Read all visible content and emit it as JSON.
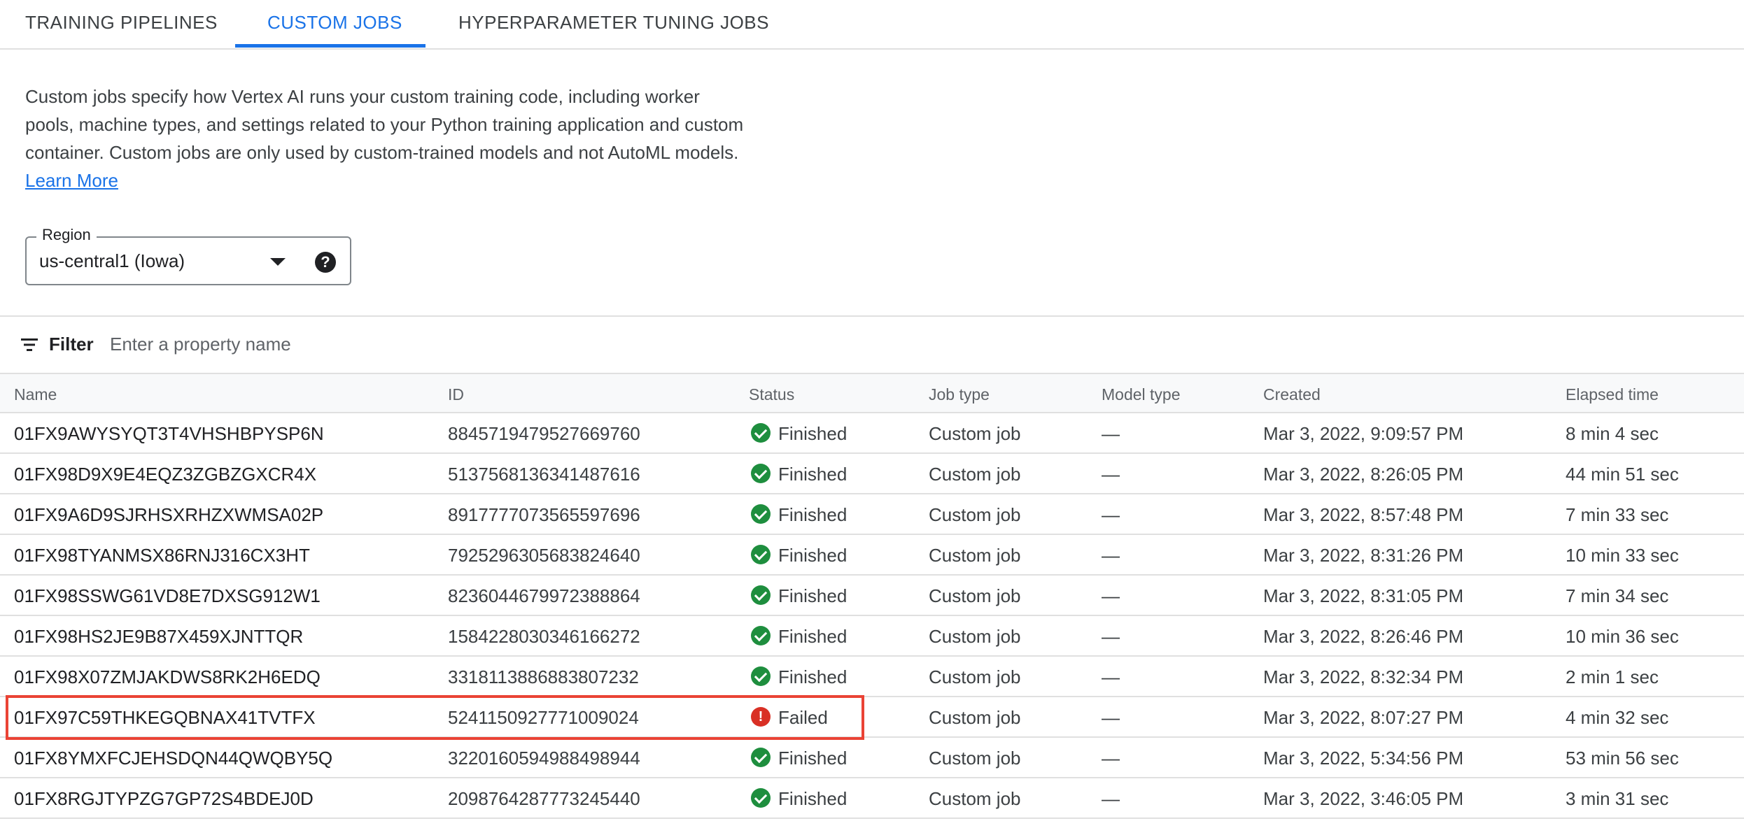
{
  "tabs": [
    {
      "label": "TRAINING PIPELINES",
      "active": false
    },
    {
      "label": "CUSTOM JOBS",
      "active": true
    },
    {
      "label": "HYPERPARAMETER TUNING JOBS",
      "active": false
    }
  ],
  "description": {
    "text": "Custom jobs specify how Vertex AI runs your custom training code, including worker pools, machine types, and settings related to your Python training application and custom container. Custom jobs are only used by custom-trained models and not AutoML models.",
    "link_label": "Learn More"
  },
  "region": {
    "label": "Region",
    "value": "us-central1 (Iowa)",
    "help_icon": "help-icon"
  },
  "filter": {
    "label": "Filter",
    "placeholder": "Enter a property name",
    "icon": "filter-icon"
  },
  "table": {
    "columns": [
      "Name",
      "ID",
      "Status",
      "Job type",
      "Model type",
      "Created",
      "Elapsed time"
    ],
    "rows": [
      {
        "name": "01FX9AWYSYQT3T4VHSHBPYSP6N",
        "id": "8845719479527669760",
        "status": "Finished",
        "job_type": "Custom job",
        "model_type": "—",
        "created": "Mar 3, 2022, 9:09:57 PM",
        "elapsed": "8 min 4 sec"
      },
      {
        "name": "01FX98D9X9E4EQZ3ZGBZGXCR4X",
        "id": "5137568136341487616",
        "status": "Finished",
        "job_type": "Custom job",
        "model_type": "—",
        "created": "Mar 3, 2022, 8:26:05 PM",
        "elapsed": "44 min 51 sec"
      },
      {
        "name": "01FX9A6D9SJRHSXRHZXWMSA02P",
        "id": "8917777073565597696",
        "status": "Finished",
        "job_type": "Custom job",
        "model_type": "—",
        "created": "Mar 3, 2022, 8:57:48 PM",
        "elapsed": "7 min 33 sec"
      },
      {
        "name": "01FX98TYANMSX86RNJ316CX3HT",
        "id": "7925296305683824640",
        "status": "Finished",
        "job_type": "Custom job",
        "model_type": "—",
        "created": "Mar 3, 2022, 8:31:26 PM",
        "elapsed": "10 min 33 sec"
      },
      {
        "name": "01FX98SSWG61VD8E7DXSG912W1",
        "id": "8236044679972388864",
        "status": "Finished",
        "job_type": "Custom job",
        "model_type": "—",
        "created": "Mar 3, 2022, 8:31:05 PM",
        "elapsed": "7 min 34 sec"
      },
      {
        "name": "01FX98HS2JE9B87X459XJNTTQR",
        "id": "1584228030346166272",
        "status": "Finished",
        "job_type": "Custom job",
        "model_type": "—",
        "created": "Mar 3, 2022, 8:26:46 PM",
        "elapsed": "10 min 36 sec"
      },
      {
        "name": "01FX98X07ZMJAKDWS8RK2H6EDQ",
        "id": "3318113886883807232",
        "status": "Finished",
        "job_type": "Custom job",
        "model_type": "—",
        "created": "Mar 3, 2022, 8:32:34 PM",
        "elapsed": "2 min 1 sec"
      },
      {
        "name": "01FX97C59THKEGQBNAX41TVTFX",
        "id": "5241150927771009024",
        "status": "Failed",
        "job_type": "Custom job",
        "model_type": "—",
        "created": "Mar 3, 2022, 8:07:27 PM",
        "elapsed": "4 min 32 sec"
      },
      {
        "name": "01FX8YMXFCJEHSDQN44QWQBY5Q",
        "id": "3220160594988498944",
        "status": "Finished",
        "job_type": "Custom job",
        "model_type": "—",
        "created": "Mar 3, 2022, 5:34:56 PM",
        "elapsed": "53 min 56 sec"
      },
      {
        "name": "01FX8RGJTYPZG7GP72S4BDEJ0D",
        "id": "2098764287773245440",
        "status": "Finished",
        "job_type": "Custom job",
        "model_type": "—",
        "created": "Mar 3, 2022, 3:46:05 PM",
        "elapsed": "3 min 31 sec"
      }
    ]
  },
  "colors": {
    "accent": "#1a73e8",
    "success": "#1e8e3e",
    "error": "#d93025",
    "highlight": "#ea4335"
  }
}
